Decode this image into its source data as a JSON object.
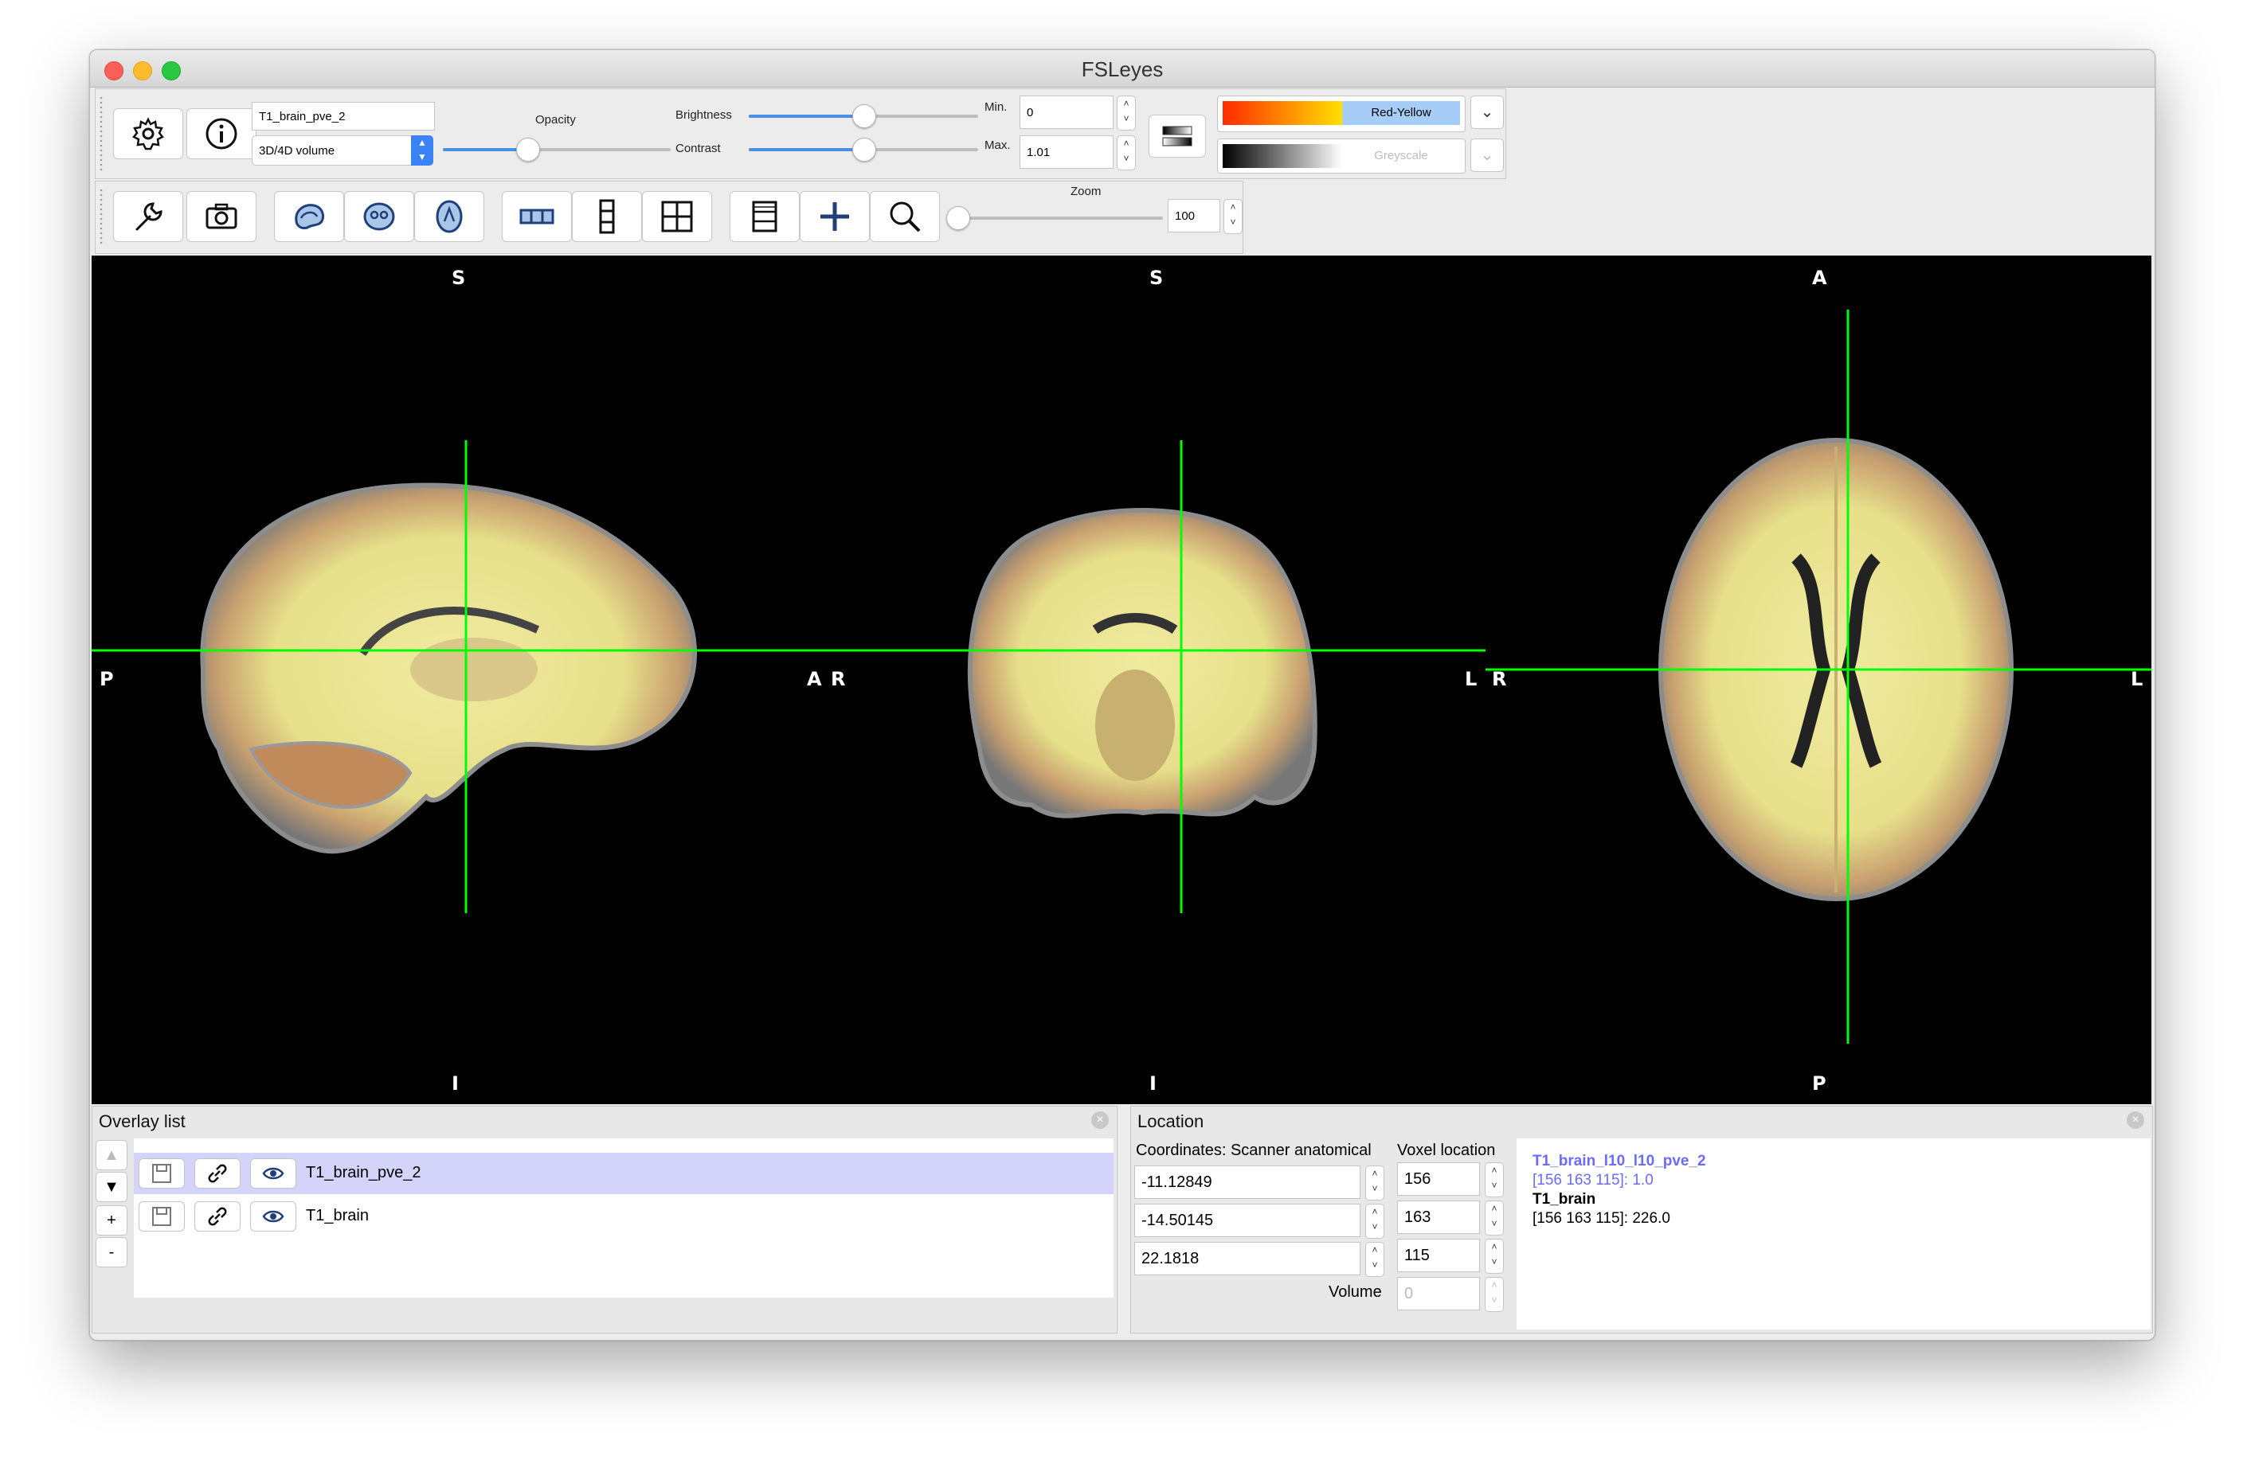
{
  "window": {
    "title": "FSLeyes"
  },
  "overlay_settings": {
    "overlay_name": "T1_brain_pve_2",
    "overlay_type": "3D/4D volume",
    "opacity_label": "Opacity",
    "opacity_value": 0.3,
    "brightness_label": "Brightness",
    "brightness_value": 0.5,
    "contrast_label": "Contrast",
    "contrast_value": 0.5,
    "min_label": "Min.",
    "min_value": "0",
    "max_label": "Max.",
    "max_value": "1.01",
    "colormap": "Red-Yellow",
    "neg_colormap": "Greyscale",
    "colors": {
      "cmap_red": "#ff2a00",
      "cmap_yellow": "#ffe000",
      "cmap_selected": "#a6cdf7"
    }
  },
  "view_toolbar": {
    "icons": [
      "wrench-icon",
      "camera-icon",
      "sagittal-icon",
      "coronal-icon",
      "axial-icon",
      "horizontal-layout-icon",
      "vertical-layout-icon",
      "grid-layout-icon",
      "movie-icon",
      "cursor-plus-icon",
      "zoom-icon"
    ],
    "zoom_label": "Zoom",
    "zoom_value": "100"
  },
  "viewer": {
    "sagittal": {
      "top": "S",
      "bottom": "I",
      "left": "P",
      "right": "A"
    },
    "coronal": {
      "top": "S",
      "bottom": "I",
      "left": "R",
      "right": "L"
    },
    "axial": {
      "top": "A",
      "bottom": "P",
      "left": "R",
      "right": "L"
    },
    "cursor_color": "#00ff00"
  },
  "overlay_list": {
    "title": "Overlay list",
    "items": [
      {
        "name": "T1_brain_pve_2",
        "selected": true
      },
      {
        "name": "T1_brain",
        "selected": false
      }
    ],
    "buttons": {
      "up": "▲",
      "down": "▼",
      "add": "+",
      "remove": "-"
    }
  },
  "location": {
    "title": "Location",
    "coords_label": "Coordinates: Scanner anatomical",
    "voxel_label": "Voxel location",
    "coords": [
      "-11.12849",
      "-14.50145",
      "22.1818"
    ],
    "voxels": [
      "156",
      "163",
      "115"
    ],
    "volume_label": "Volume",
    "volume_value": "0",
    "info": [
      {
        "name": "T1_brain_l10_l10_pve_2",
        "value": "[156 163 115]: 1.0",
        "color": "#6b6bff"
      },
      {
        "name": "T1_brain",
        "value": "[156 163 115]: 226.0",
        "color": "#000000"
      }
    ]
  }
}
